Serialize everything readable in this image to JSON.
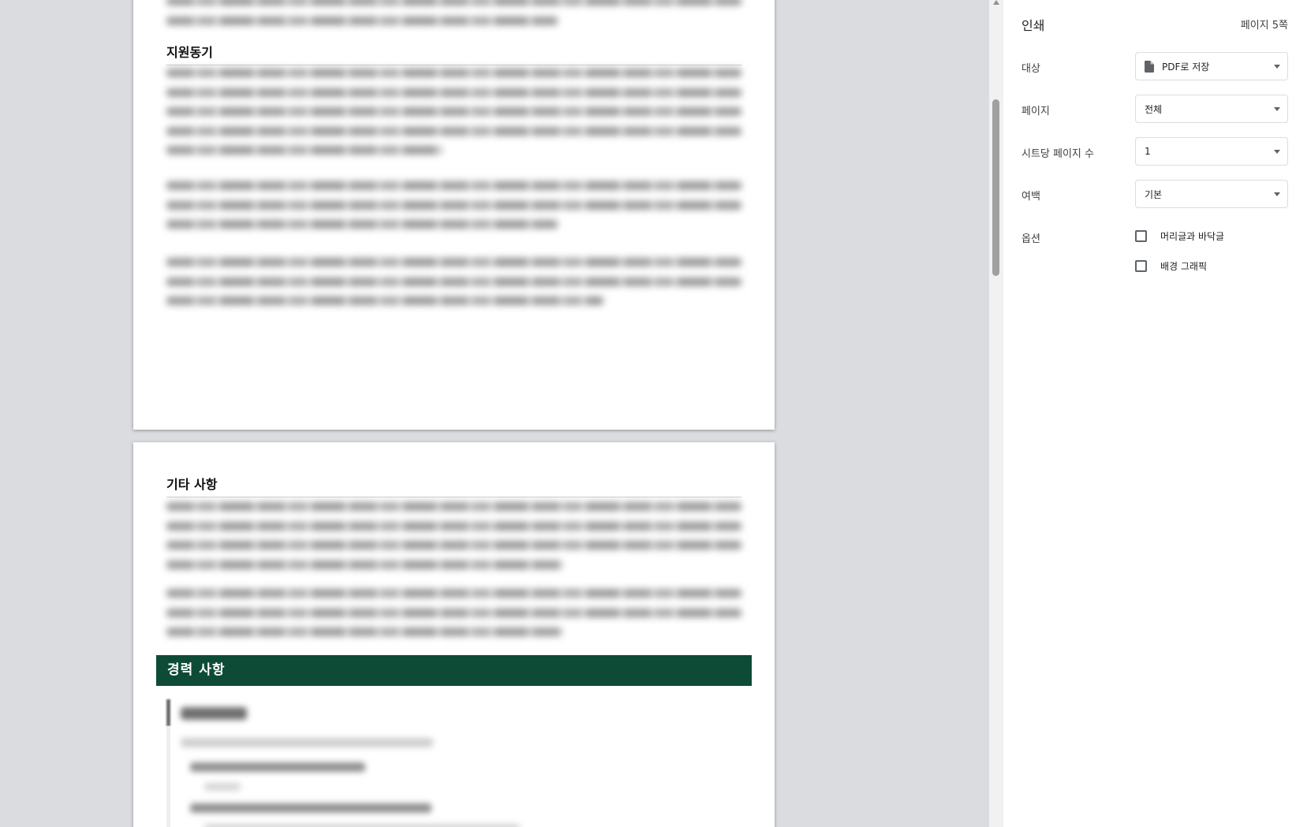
{
  "preview": {
    "page1": {
      "heading_motivation": "지원동기"
    },
    "page2": {
      "heading_etc": "기타 사항",
      "career_banner": "경력 사항"
    }
  },
  "panel": {
    "title": "인쇄",
    "page_count": "페이지 5쪽",
    "destination": {
      "label": "대상",
      "value": "PDF로 저장",
      "icon": "file-icon"
    },
    "pages": {
      "label": "페이지",
      "value": "전체"
    },
    "pages_per_sheet": {
      "label": "시트당 페이지 수",
      "value": "1"
    },
    "margins": {
      "label": "여백",
      "value": "기본"
    },
    "options": {
      "label": "옵션",
      "headers_footers": {
        "label": "머리글과 바닥글",
        "checked": false
      },
      "background_graphics": {
        "label": "배경 그래픽",
        "checked": false
      }
    }
  },
  "colors": {
    "banner_green": "#0e4b36",
    "preview_bg": "#dadce0"
  }
}
